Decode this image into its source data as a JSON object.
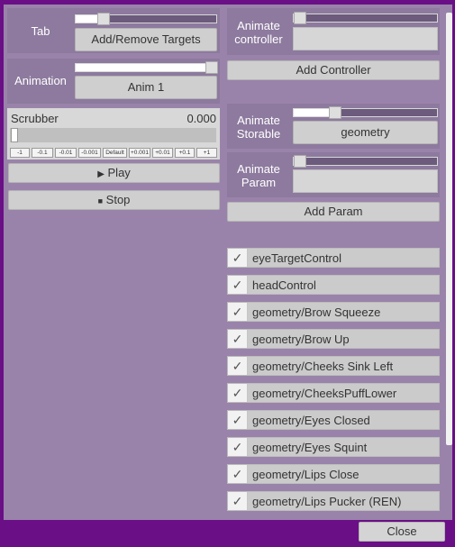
{
  "left": {
    "tab_label": "Tab",
    "targets_button": "Add/Remove Targets",
    "animation_label": "Animation",
    "animation_value": "Anim 1",
    "scrubber_label": "Scrubber",
    "scrubber_value": "0.000",
    "step_buttons": [
      "-1",
      "-0.1",
      "-0.01",
      "-0.001",
      "Default",
      "+0.001",
      "+0.01",
      "+0.1",
      "+1"
    ],
    "play_label": "Play",
    "stop_label": "Stop",
    "tab_slider_level": 0.25,
    "animation_slider_level": 1.0,
    "scrubber_level": 0.0
  },
  "right": {
    "controller_label": "Animate controller",
    "add_controller": "Add Controller",
    "storable_label": "Animate Storable",
    "storable_value": "geometry",
    "param_label": "Animate Param",
    "add_param": "Add Param",
    "storable_slider_level": 0.3,
    "items": [
      {
        "label": "eyeTargetControl",
        "checked": true
      },
      {
        "label": "headControl",
        "checked": true
      },
      {
        "label": "geometry/Brow Squeeze",
        "checked": true
      },
      {
        "label": "geometry/Brow Up",
        "checked": true
      },
      {
        "label": "geometry/Cheeks Sink Left",
        "checked": true
      },
      {
        "label": "geometry/CheeksPuffLower",
        "checked": true
      },
      {
        "label": "geometry/Eyes Closed",
        "checked": true
      },
      {
        "label": "geometry/Eyes Squint",
        "checked": true
      },
      {
        "label": "geometry/Lips Close",
        "checked": true
      },
      {
        "label": "geometry/Lips Pucker (REN)",
        "checked": true
      }
    ]
  },
  "footer": {
    "close_label": "Close"
  },
  "icons": {
    "play": "play-icon",
    "stop": "stop-icon",
    "check": "checkmark-icon"
  },
  "colors": {
    "window": "#6a0f86",
    "panel": "#9a83aa"
  }
}
